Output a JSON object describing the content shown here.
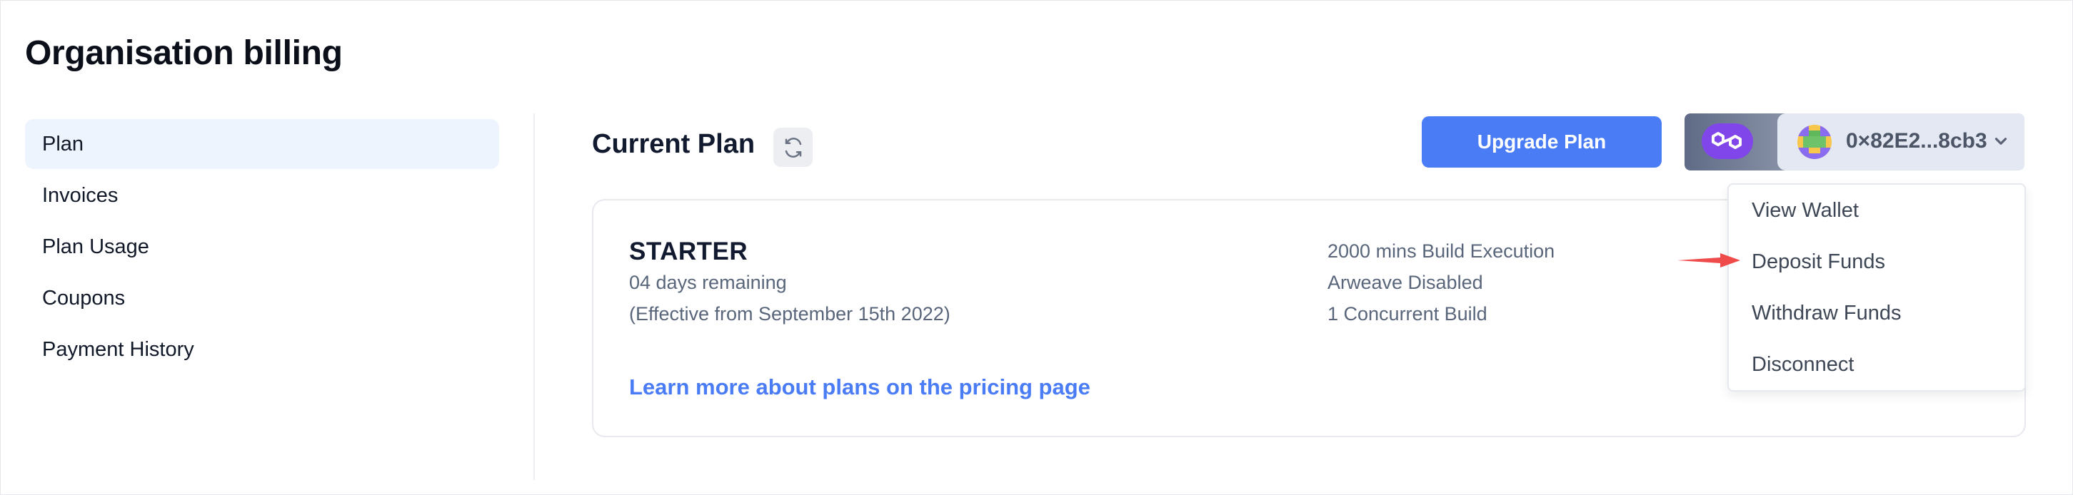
{
  "page": {
    "title": "Organisation billing"
  },
  "sidebar": {
    "items": [
      {
        "label": "Plan",
        "active": true
      },
      {
        "label": "Invoices"
      },
      {
        "label": "Plan Usage"
      },
      {
        "label": "Coupons"
      },
      {
        "label": "Payment History"
      }
    ]
  },
  "main": {
    "section_title": "Current Plan",
    "refresh_icon": "refresh-icon",
    "upgrade_label": "Upgrade Plan"
  },
  "wallet": {
    "network_icon": "polygon-icon",
    "avatar_icon": "pixel-avatar",
    "address": "0×82E2...8cb3",
    "chevron_icon": "chevron-down-icon"
  },
  "plan": {
    "name": "STARTER",
    "remaining": "04 days remaining",
    "effective": "(Effective from September 15th 2022)",
    "features": [
      "2000 mins Build Execution",
      "Arweave Disabled",
      "1 Concurrent Build"
    ],
    "pricing_link": "Learn more about plans on the pricing page"
  },
  "wallet_menu": {
    "items": [
      {
        "label": "View Wallet"
      },
      {
        "label": "Deposit Funds"
      },
      {
        "label": "Withdraw Funds"
      },
      {
        "label": "Disconnect"
      }
    ]
  },
  "colors": {
    "accent": "#4a7cf6",
    "sidebar_active": "#eef4fe",
    "network": "#8146e9",
    "annotation_arrow": "#f04b4b"
  }
}
